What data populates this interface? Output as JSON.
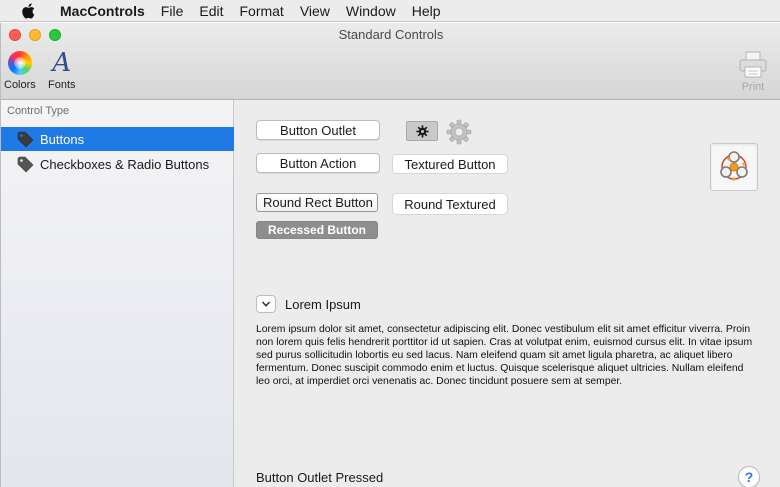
{
  "menubar": {
    "app_name": "MacControls",
    "items": [
      "File",
      "Edit",
      "Format",
      "View",
      "Window",
      "Help"
    ]
  },
  "window": {
    "title": "Standard Controls"
  },
  "toolbar": {
    "colors_label": "Colors",
    "fonts_label": "Fonts",
    "fonts_glyph": "A",
    "print_label": "Print"
  },
  "sidebar": {
    "header": "Control Type",
    "items": [
      {
        "label": "Buttons",
        "selected": true
      },
      {
        "label": "Checkboxes & Radio Buttons",
        "selected": false
      }
    ]
  },
  "main": {
    "button_outlet": "Button Outlet",
    "button_action": "Button Action",
    "textured_button": "Textured Button",
    "round_rect_button": "Round Rect Button",
    "round_textured": "Round Textured",
    "recessed_button": "Recessed Button",
    "disclosure_label": "Lorem Ipsum",
    "lorem_text": "Lorem ipsum dolor sit amet, consectetur adipiscing elit. Donec vestibulum elit sit amet efficitur viverra. Proin non lorem quis felis hendrerit porttitor id ut sapien. Cras at volutpat enim, euismod cursus elit. In vitae ipsum sed purus sollicitudin lobortis eu sed lacus. Nam eleifend quam sit amet ligula pharetra, ac aliquet libero fermentum. Donec suscipit commodo enim et luctus. Quisque scelerisque aliquet ultricies. Nullam eleifend leo orci, at imperdiet orci venenatis ac. Donec tincidunt posuere sem at semper.",
    "status_text": "Button Outlet Pressed",
    "help_glyph": "?"
  },
  "icons": {
    "apple": "apple-icon",
    "colors": "color-wheel-icon",
    "fonts": "fonts-icon",
    "print": "printer-icon",
    "tag": "tag-icon",
    "gear": "gear-icon",
    "gear_outline": "gear-outline-icon",
    "image_well": "network-graph-icon",
    "disclosure": "chevron-down-icon",
    "help": "help-icon"
  },
  "colors": {
    "selection": "#1f7ae6",
    "close": "#fc5f57",
    "minimize": "#fdbc2e",
    "zoom": "#28c840",
    "recessed": "#8e8e8e"
  }
}
